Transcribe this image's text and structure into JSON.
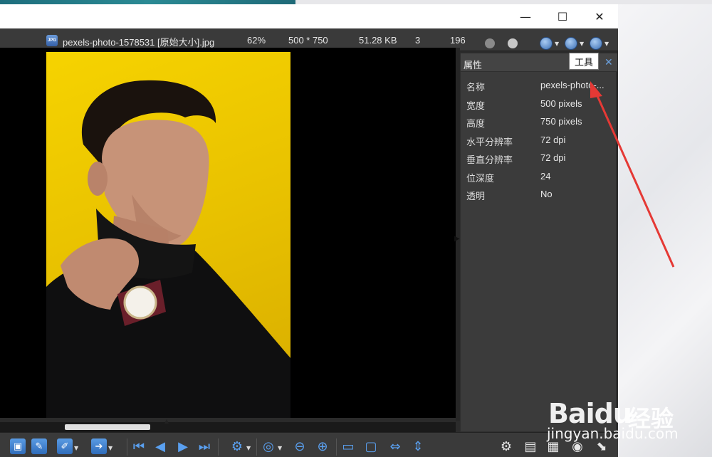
{
  "window": {
    "minimize_glyph": "—",
    "maximize_glyph": "☐",
    "close_glyph": "✕"
  },
  "infobar": {
    "file_name": "pexels-photo-1578531 [原始大小].jpg",
    "file_icon_text": "JPG",
    "zoom": "62%",
    "dimensions": "500 * 750",
    "file_size": "51.28 KB",
    "count_a": "3",
    "count_b": "196"
  },
  "panel": {
    "title": "属性",
    "close_glyph": "✕",
    "tooltip": "工具",
    "rows": [
      {
        "key": "名称",
        "value": "pexels-photo-..."
      },
      {
        "key": "宽度",
        "value": "500 pixels"
      },
      {
        "key": "高度",
        "value": "750 pixels"
      },
      {
        "key": "水平分辨率",
        "value": "72 dpi"
      },
      {
        "key": "垂直分辨率",
        "value": "72 dpi"
      },
      {
        "key": "位深度",
        "value": "24"
      },
      {
        "key": "透明",
        "value": "No"
      }
    ]
  },
  "toolbar": {
    "first_icon": "⏮",
    "prev_icon": "◀",
    "next_icon": "▶",
    "last_icon": "⏭",
    "gear_icon": "⚙",
    "zoom_out_icon": "🔍",
    "arrow_right_icon": "➔"
  },
  "watermark": {
    "brand": "Bai",
    "brand2": "du",
    "cn": "经验",
    "url": "jingyan.baidu.com"
  },
  "colors": {
    "annotation": "#e53935",
    "panel_bg": "#3b3b3b",
    "accent_blue": "#3c6fb3"
  }
}
